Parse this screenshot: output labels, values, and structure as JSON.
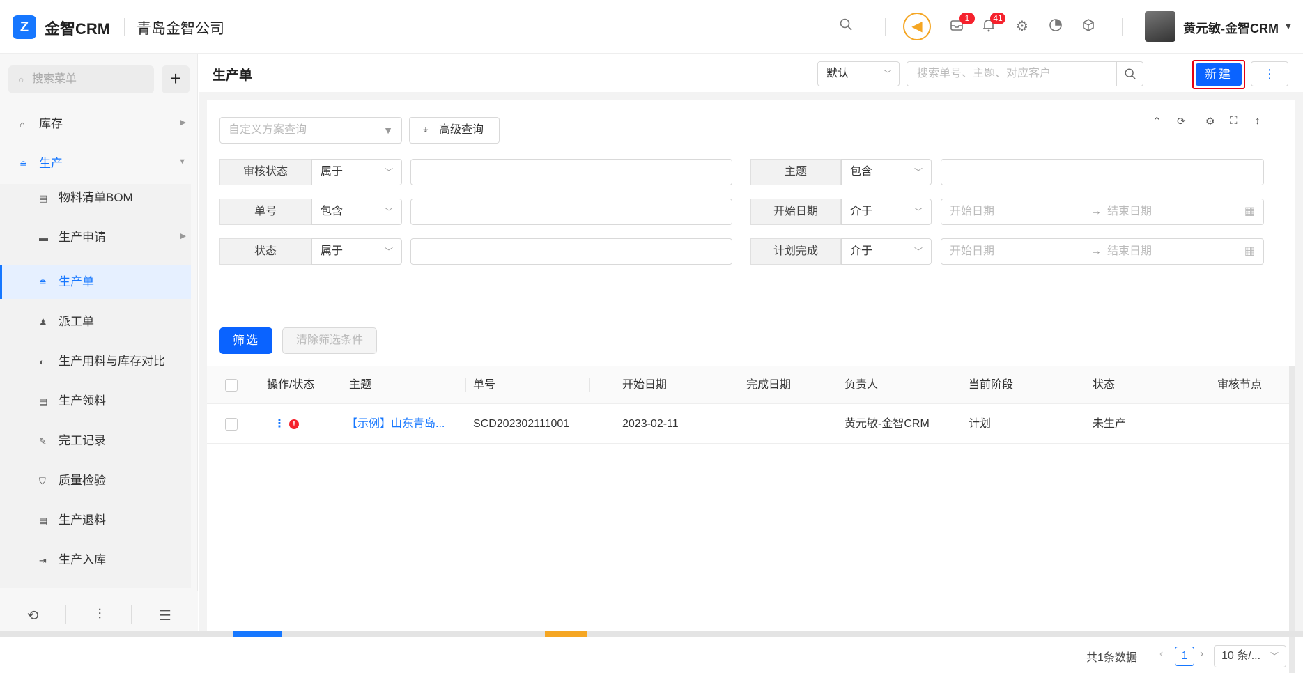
{
  "topbar": {
    "logo_glyph": "Z",
    "brand": "金智CRM",
    "company": "青岛金智公司",
    "mail_badge": "1",
    "bell_badge": "41",
    "user_name": "黄元敏-金智CRM"
  },
  "sidebar": {
    "search_placeholder": "搜索菜单",
    "items": [
      {
        "label": "库存",
        "icon": "warehouse-icon"
      },
      {
        "label": "生产",
        "icon": "production-icon"
      },
      {
        "label": "物料清单BOM",
        "icon": "document-icon"
      },
      {
        "label": "生产申请",
        "icon": "folder-icon"
      },
      {
        "label": "生产单",
        "icon": "production-icon"
      },
      {
        "label": "派工单",
        "icon": "worker-icon"
      },
      {
        "label": "生产用料与库存对比",
        "icon": "contrast-icon"
      },
      {
        "label": "生产领料",
        "icon": "document-icon"
      },
      {
        "label": "完工记录",
        "icon": "edit-icon"
      },
      {
        "label": "质量检验",
        "icon": "shield-icon"
      },
      {
        "label": "生产退料",
        "icon": "document-icon"
      },
      {
        "label": "生产入库",
        "icon": "inbound-icon"
      }
    ]
  },
  "main": {
    "page_title": "生产单",
    "view_select": "默认",
    "search_placeholder": "搜索单号、主题、对应客户",
    "new_button": "新建",
    "scheme_placeholder": "自定义方案查询",
    "advanced_query": "高级查询",
    "filters": {
      "audit_status": {
        "label": "审核状态",
        "op": "属于"
      },
      "subject": {
        "label": "主题",
        "op": "包含"
      },
      "number": {
        "label": "单号",
        "op": "包含"
      },
      "start_date": {
        "label": "开始日期",
        "op": "介于",
        "from": "开始日期",
        "to": "结束日期"
      },
      "status": {
        "label": "状态",
        "op": "属于"
      },
      "plan_done": {
        "label": "计划完成",
        "op": "介于",
        "from": "开始日期",
        "to": "结束日期"
      }
    },
    "filter_button": "筛选",
    "clear_button": "清除筛选条件",
    "table": {
      "columns": [
        "操作/状态",
        "主题",
        "单号",
        "开始日期",
        "完成日期",
        "负责人",
        "当前阶段",
        "状态",
        "审核节点"
      ],
      "rows": [
        {
          "subject": "【示例】山东青岛...",
          "number": "SCD202302111001",
          "start_date": "2023-02-11",
          "done_date": "",
          "owner": "黄元敏-金智CRM",
          "stage": "计划",
          "status": "未生产",
          "audit_node": ""
        }
      ]
    },
    "pagination": {
      "total": "共1条数据",
      "page": "1",
      "page_size": "10 条/..."
    }
  },
  "colors": {
    "primary": "#0a63ff",
    "highlight_box": "#e60012",
    "alert": "#f5222d",
    "speaker": "#f5a623"
  }
}
